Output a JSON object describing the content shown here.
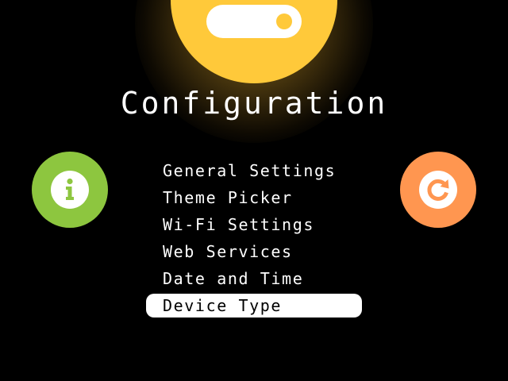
{
  "title": "Configuration",
  "colors": {
    "background": "#000000",
    "hero": "#FFC93A",
    "info_button": "#8DC63F",
    "refresh_button": "#FF9650",
    "text": "#FFFFFF"
  },
  "hero": {
    "icon": "toggle-switch-icon",
    "state": "on"
  },
  "left_button": {
    "icon": "info-icon"
  },
  "right_button": {
    "icon": "refresh-icon"
  },
  "menu": {
    "items": [
      {
        "label": "General Settings",
        "selected": false
      },
      {
        "label": "Theme Picker",
        "selected": false
      },
      {
        "label": "Wi-Fi Settings",
        "selected": false
      },
      {
        "label": "Web Services",
        "selected": false
      },
      {
        "label": "Date and Time",
        "selected": false
      },
      {
        "label": "Device Type",
        "selected": true
      }
    ]
  }
}
